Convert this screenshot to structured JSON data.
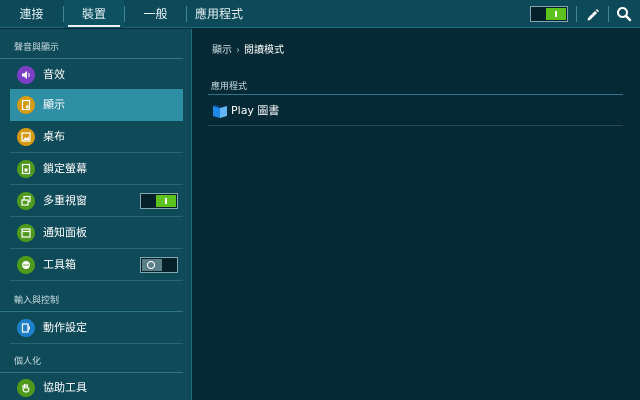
{
  "tabs": [
    {
      "label": "連接"
    },
    {
      "label": "裝置"
    },
    {
      "label": "一般"
    },
    {
      "label": "應用程式"
    }
  ],
  "active_tab": "裝置",
  "header_toggle_state": "on",
  "header_icons": [
    "edit-icon",
    "search-icon"
  ],
  "sidebar": {
    "sections": [
      {
        "title": "聲音與顯示"
      },
      {
        "title": "輸入與控制"
      },
      {
        "title": "個人化"
      }
    ],
    "items": [
      {
        "label": "音效",
        "icon": "sound-icon",
        "color": "#7b3fc6"
      },
      {
        "label": "顯示",
        "icon": "display-icon",
        "color": "#d49a12",
        "selected": true
      },
      {
        "label": "桌布",
        "icon": "wallpaper-icon",
        "color": "#d49a12"
      },
      {
        "label": "鎖定螢幕",
        "icon": "lock-screen-icon",
        "color": "#4f9a1c"
      },
      {
        "label": "多重視窗",
        "icon": "multi-window-icon",
        "color": "#4f9a1c",
        "toggle": "on"
      },
      {
        "label": "通知面板",
        "icon": "notification-panel-icon",
        "color": "#4f9a1c"
      },
      {
        "label": "工具箱",
        "icon": "toolbox-icon",
        "color": "#4f9a1c",
        "toggle": "off"
      },
      {
        "label": "動作設定",
        "icon": "motion-icon",
        "color": "#1d7fc9"
      },
      {
        "label": "協助工具",
        "icon": "accessibility-icon",
        "color": "#4f9a1c"
      }
    ]
  },
  "main": {
    "breadcrumb": {
      "parent": "顯示",
      "current": "閱讀模式"
    },
    "section_title": "應用程式",
    "apps": [
      {
        "label": "Play 圖書",
        "icon": "play-books-icon"
      }
    ]
  },
  "colors": {
    "topbar": "#0c4a5a",
    "sidebar": "#0f4a59",
    "selected": "#2e8ea3",
    "main_bg": "#062a35",
    "toggle_on": "#5ec21e"
  }
}
